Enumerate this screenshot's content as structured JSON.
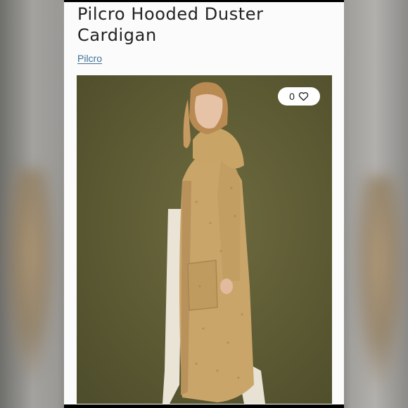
{
  "listing": {
    "title": "Pilcro Hooded Duster Cardigan",
    "brand": "Pilcro",
    "like_count": "0"
  },
  "icons": {
    "like": "heart-icon"
  },
  "colors": {
    "photo_background": "#5c5a33",
    "cardigan": "#c9a56a",
    "brand_link": "#3b6f96"
  }
}
